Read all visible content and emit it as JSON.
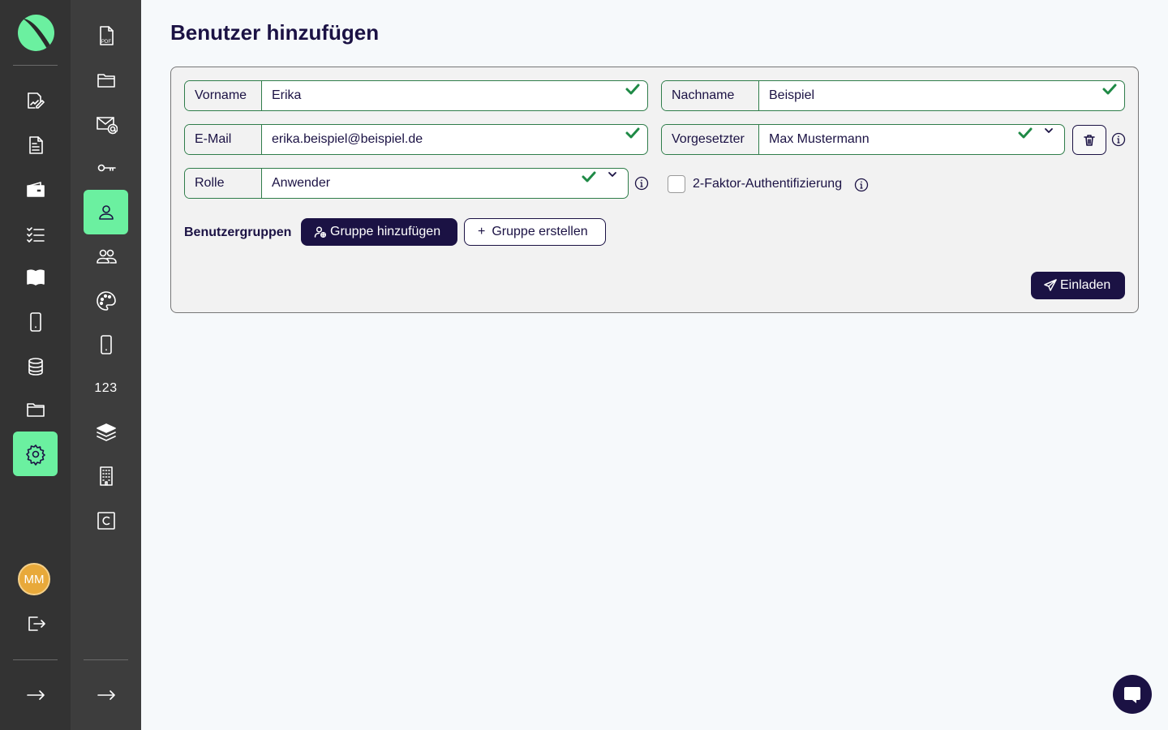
{
  "app": {
    "avatar_initials": "MM",
    "colors": {
      "accent": "#6bf0a0",
      "primary": "#1b1244",
      "valid": "#1f8a46",
      "avatar": "#e8a93a"
    }
  },
  "sidebar_primary": {
    "items": [
      {
        "icon": "edit-document-icon"
      },
      {
        "icon": "document-icon"
      },
      {
        "icon": "wallet-icon"
      },
      {
        "icon": "checklist-icon"
      },
      {
        "icon": "book-icon"
      },
      {
        "icon": "smartphone-icon"
      },
      {
        "icon": "database-icon"
      },
      {
        "icon": "folder-icon"
      },
      {
        "icon": "settings-icon",
        "active": true
      }
    ],
    "logout_icon": "logout-icon",
    "expand_icon": "arrow-right-icon"
  },
  "sidebar_secondary": {
    "items": [
      {
        "icon": "pdf-file-icon"
      },
      {
        "icon": "folder-open-icon"
      },
      {
        "icon": "mail-at-icon"
      },
      {
        "icon": "key-icon"
      },
      {
        "icon": "user-icon",
        "active": true
      },
      {
        "icon": "users-icon"
      },
      {
        "icon": "palette-icon"
      },
      {
        "icon": "smartphone-icon"
      },
      {
        "icon": "numbers-icon",
        "text": "123"
      },
      {
        "icon": "layers-icon"
      },
      {
        "icon": "building-icon"
      },
      {
        "icon": "c-square-icon"
      }
    ],
    "expand_icon": "arrow-right-icon"
  },
  "page": {
    "title": "Benutzer hinzufügen"
  },
  "form": {
    "firstname": {
      "label": "Vorname",
      "value": "Erika"
    },
    "lastname": {
      "label": "Nachname",
      "value": "Beispiel"
    },
    "email": {
      "label": "E-Mail",
      "value": "erika.beispiel@beispiel.de"
    },
    "supervisor": {
      "label": "Vorgesetzter",
      "value": "Max Mustermann"
    },
    "role": {
      "label": "Rolle",
      "value": "Anwender"
    },
    "two_factor": {
      "label": "2-Faktor-Authentifizierung",
      "checked": false
    },
    "groups_label": "Benutzergruppen",
    "add_group_label": "Gruppe hinzufügen",
    "create_group_label": "Gruppe erstellen",
    "invite_label": "Einladen"
  }
}
